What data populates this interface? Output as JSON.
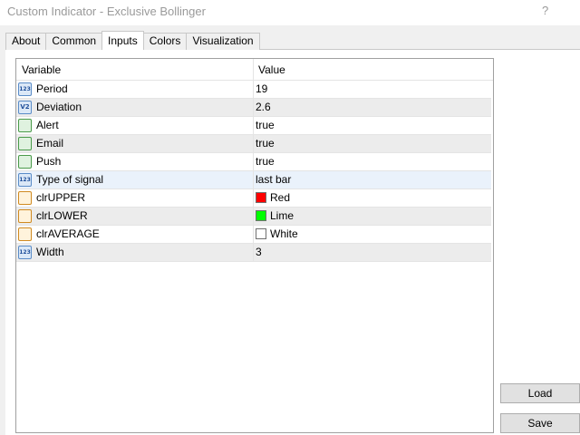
{
  "window": {
    "title": "Custom Indicator - Exclusive Bollinger",
    "help_label": "?"
  },
  "tabs": [
    {
      "label": "About"
    },
    {
      "label": "Common"
    },
    {
      "label": "Inputs",
      "active": true
    },
    {
      "label": "Colors"
    },
    {
      "label": "Visualization"
    }
  ],
  "grid": {
    "header": {
      "variable": "Variable",
      "value": "Value"
    },
    "rows": [
      {
        "icon": "integer-icon",
        "icon_text": "123",
        "variable": "Period",
        "value": "19"
      },
      {
        "icon": "double-icon",
        "icon_text": "V2",
        "variable": "Deviation",
        "value": "2.6"
      },
      {
        "icon": "bool-icon",
        "icon_text": "",
        "variable": "Alert",
        "value": "true"
      },
      {
        "icon": "bool-icon",
        "icon_text": "",
        "variable": "Email",
        "value": "true"
      },
      {
        "icon": "bool-icon",
        "icon_text": "",
        "variable": "Push",
        "value": "true"
      },
      {
        "icon": "integer-icon",
        "icon_text": "123",
        "variable": "Type of signal",
        "value": "last bar",
        "selected": true
      },
      {
        "icon": "color-icon",
        "icon_text": "",
        "variable": "clrUPPER",
        "value": "Red",
        "swatch": "#ff0000"
      },
      {
        "icon": "color-icon",
        "icon_text": "",
        "variable": "clrLOWER",
        "value": "Lime",
        "swatch": "#00ff00"
      },
      {
        "icon": "color-icon",
        "icon_text": "",
        "variable": "clrAVERAGE",
        "value": "White",
        "swatch": "#ffffff"
      },
      {
        "icon": "integer-icon",
        "icon_text": "123",
        "variable": "Width",
        "value": "3"
      }
    ]
  },
  "buttons": {
    "load_label": "Load",
    "save_label": "Save"
  }
}
